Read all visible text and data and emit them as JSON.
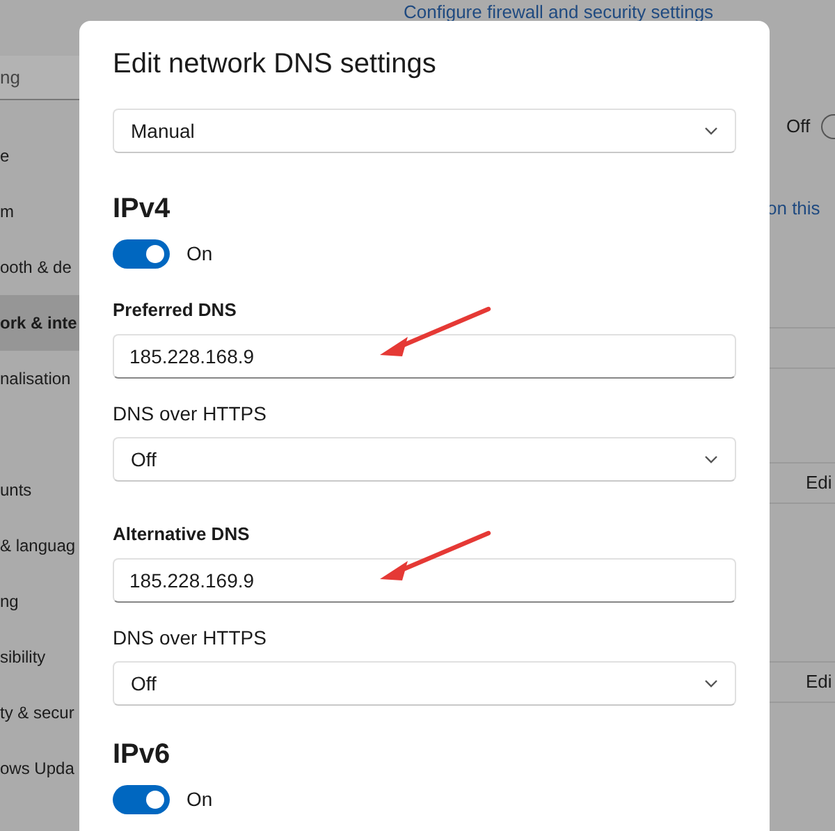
{
  "background": {
    "top_link": "Configure firewall and security settings",
    "search": {
      "placeholder": "ng"
    },
    "sidebar": {
      "groups": [
        {
          "items": [
            {
              "label": "e",
              "selected": false
            },
            {
              "label": "m",
              "selected": false
            },
            {
              "label": "ooth & de",
              "selected": false
            },
            {
              "label": "ork & inte",
              "selected": true
            },
            {
              "label": "nalisation",
              "selected": false
            }
          ]
        },
        {
          "items": [
            {
              "label": "unts",
              "selected": false
            },
            {
              "label": "& languag",
              "selected": false
            },
            {
              "label": "ng",
              "selected": false
            },
            {
              "label": "sibility",
              "selected": false
            },
            {
              "label": "ty & secur",
              "selected": false
            },
            {
              "label": "ows Upda",
              "selected": false
            }
          ]
        }
      ]
    },
    "right": {
      "toggle": {
        "on": false,
        "label": "Off"
      },
      "link": "on this",
      "edit_buttons": [
        "Edi",
        "Edi"
      ]
    }
  },
  "dialog": {
    "title": "Edit network DNS settings",
    "mode": "Manual",
    "sections": [
      {
        "heading": "IPv4",
        "toggle": {
          "on": true,
          "label": "On"
        },
        "fields": [
          {
            "label": "Preferred DNS",
            "value": "185.228.168.9",
            "doh_label": "DNS over HTTPS",
            "doh_value": "Off"
          },
          {
            "label": "Alternative DNS",
            "value": "185.228.169.9",
            "doh_label": "DNS over HTTPS",
            "doh_value": "Off"
          }
        ]
      },
      {
        "heading": "IPv6",
        "toggle": {
          "on": true,
          "label": "On"
        }
      }
    ]
  }
}
